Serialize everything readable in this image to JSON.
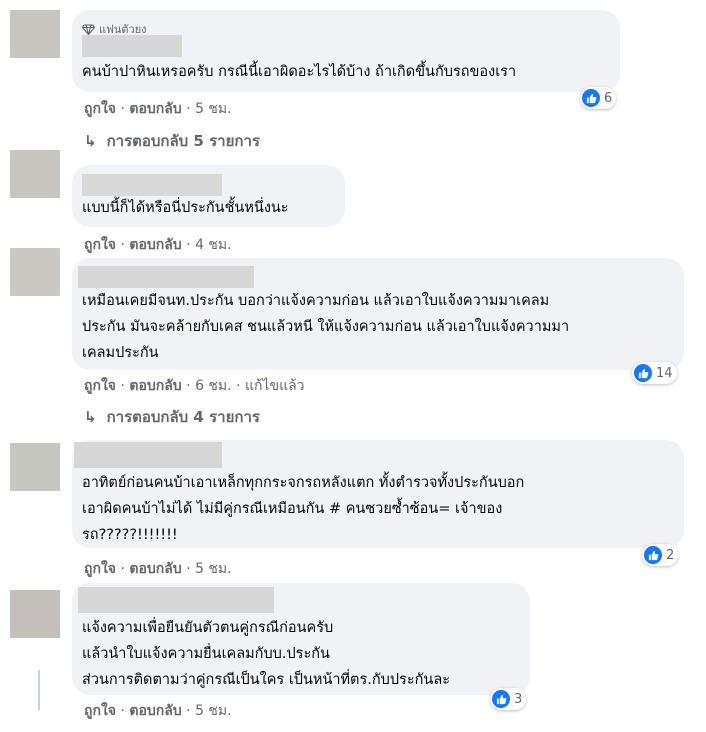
{
  "comments": [
    {
      "badge": "แฟนตัวยง",
      "text": "คนบ้าปาหินเหรอครับ กรณีนี้เอาผิดอะไรได้บ้าง ถ้าเกิดขึ้นกับรถของเรา",
      "like": "ถูกใจ",
      "reply": "ตอบกลับ",
      "time": "5 ชม.",
      "reactions": "6",
      "replies": "การตอบกลับ 5 รายการ"
    },
    {
      "text": "แบบนี้ก็ได้หรือนี่ประกันชั้นหนึ่งนะ",
      "like": "ถูกใจ",
      "reply": "ตอบกลับ",
      "time": "4 ชม."
    },
    {
      "text": "เหมือนเคยมีจนท.ประกัน บอกว่าแจ้งความก่อน แล้วเอาใบแจ้งความมาเคลม\nประกัน มันจะคล้ายกับเคส ชนแล้วหนี ให้แจ้งความก่อน แล้วเอาใบแจ้งความมา\nเคลมประกัน",
      "like": "ถูกใจ",
      "reply": "ตอบกลับ",
      "time": "6 ชม.",
      "edited": "แก้ไขแล้ว",
      "reactions": "14",
      "replies": "การตอบกลับ 4 รายการ"
    },
    {
      "text": "อาทิตย์ก่อนคนบ้าเอาเหล็กทุกกระจกรถหลังแตก ทั้งตำรวจทั้งประกันบอก\nเอาผิดคนบ้าไม่ได้ ไม่มีคู่กรณีเหมือนกัน # คนซวยซ้ำซ้อน= เจ้าของ\nรถ?????!!!!!!!",
      "like": "ถูกใจ",
      "reply": "ตอบกลับ",
      "time": "5 ชม.",
      "reactions": "2"
    },
    {
      "text": "แจ้งความเพื่อยืนยันตัวตนคู่กรณีก่อนครับ\nแล้วนำใบแจ้งความยื่นเคลมกับบ.ประกัน\nส่วนการติดตามว่าคู่กรณีเป็นใคร เป็นหน้าที่ตร.กับประกันละ",
      "like": "ถูกใจ",
      "reply": "ตอบกลับ",
      "time": "5 ชม.",
      "reactions": "3"
    }
  ],
  "colors": {
    "accent": "#1877f2",
    "bubble": "#f0f2f5",
    "meta": "#65676b"
  },
  "icons": {
    "reaction": "like-icon",
    "badge": "diamond-icon",
    "replies": "reply-arrow-icon"
  }
}
